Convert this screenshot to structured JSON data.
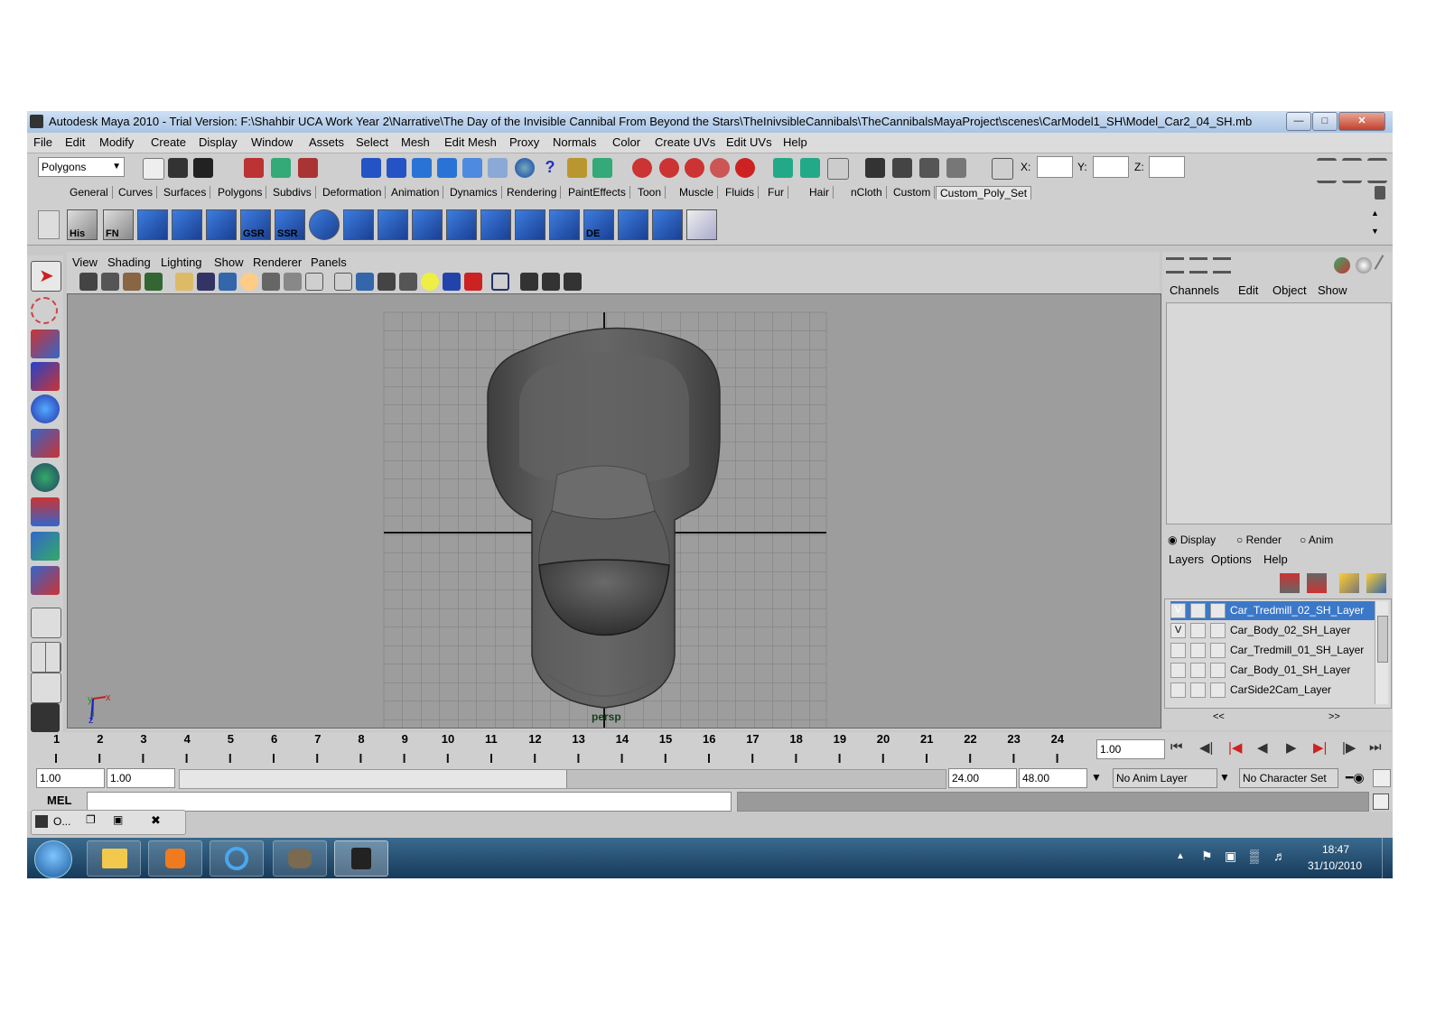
{
  "window": {
    "title": "Autodesk Maya 2010 - Trial Version: F:\\Shahbir UCA Work Year 2\\Narrative\\The Day of the Invisible Cannibal From Beyond the Stars\\TheInivsibleCannibals\\TheCannibalsMayaProject\\scenes\\CarModel1_SH\\Model_Car2_04_SH.mb"
  },
  "menubar": [
    "File",
    "Edit",
    "Modify",
    "Create",
    "Display",
    "Window",
    "Assets",
    "Select",
    "Mesh",
    "Edit Mesh",
    "Proxy",
    "Normals",
    "Color",
    "Create UVs",
    "Edit UVs",
    "Help"
  ],
  "statusline": {
    "menu_set": "Polygons",
    "x_label": "X:",
    "y_label": "Y:",
    "z_label": "Z:"
  },
  "shelf_tabs": [
    "General",
    "Curves",
    "Surfaces",
    "Polygons",
    "Subdivs",
    "Deformation",
    "Animation",
    "Dynamics",
    "Rendering",
    "PaintEffects",
    "Toon",
    "Muscle",
    "Fluids",
    "Fur",
    "Hair",
    "nCloth",
    "Custom",
    "Custom_Poly_Set"
  ],
  "shelf_icon_labels": {
    "his": "His",
    "fn": "FN",
    "gsr": "GSR",
    "ssr": "SSR",
    "de": "DE"
  },
  "panel_menu": [
    "View",
    "Shading",
    "Lighting",
    "Show",
    "Renderer",
    "Panels"
  ],
  "viewport": {
    "camera_label": "persp",
    "axis_x": "x",
    "axis_y": "y",
    "axis_z": "z"
  },
  "channel_box": {
    "menu": [
      "Channels",
      "Edit",
      "Object",
      "Show"
    ]
  },
  "layer_editor": {
    "modes": [
      "Display",
      "Render",
      "Anim"
    ],
    "menu": [
      "Layers",
      "Options",
      "Help"
    ],
    "layers": [
      {
        "visible": "V",
        "name": "Car_Tredmill_02_SH_Layer",
        "selected": true
      },
      {
        "visible": "V",
        "name": "Car_Body_02_SH_Layer",
        "selected": false
      },
      {
        "visible": "",
        "name": "Car_Tredmill_01_SH_Layer",
        "selected": false
      },
      {
        "visible": "",
        "name": "Car_Body_01_SH_Layer",
        "selected": false
      },
      {
        "visible": "",
        "name": "CarSide2Cam_Layer",
        "selected": false
      }
    ],
    "scroll_left": "<<",
    "scroll_right": ">>"
  },
  "time_slider": {
    "ticks": [
      "1",
      "2",
      "3",
      "4",
      "5",
      "6",
      "7",
      "8",
      "9",
      "10",
      "11",
      "12",
      "13",
      "14",
      "15",
      "16",
      "17",
      "18",
      "19",
      "20",
      "21",
      "22",
      "23",
      "24"
    ],
    "current_time": "1.00"
  },
  "range_slider": {
    "start_time": "1.00",
    "range_start": "1.00",
    "range_end": "24.00",
    "end_time": "48.00",
    "anim_layer": "No Anim Layer",
    "character_set": "No Character Set"
  },
  "command_line": {
    "label": "MEL"
  },
  "minimized_window": {
    "label": "O..."
  },
  "taskbar": {
    "time": "18:47",
    "date": "31/10/2010"
  },
  "colors": {
    "selected_layer": "#3c78c8",
    "viewport_bg": "#9d9d9d",
    "taskbar": "#1f4a6e"
  }
}
